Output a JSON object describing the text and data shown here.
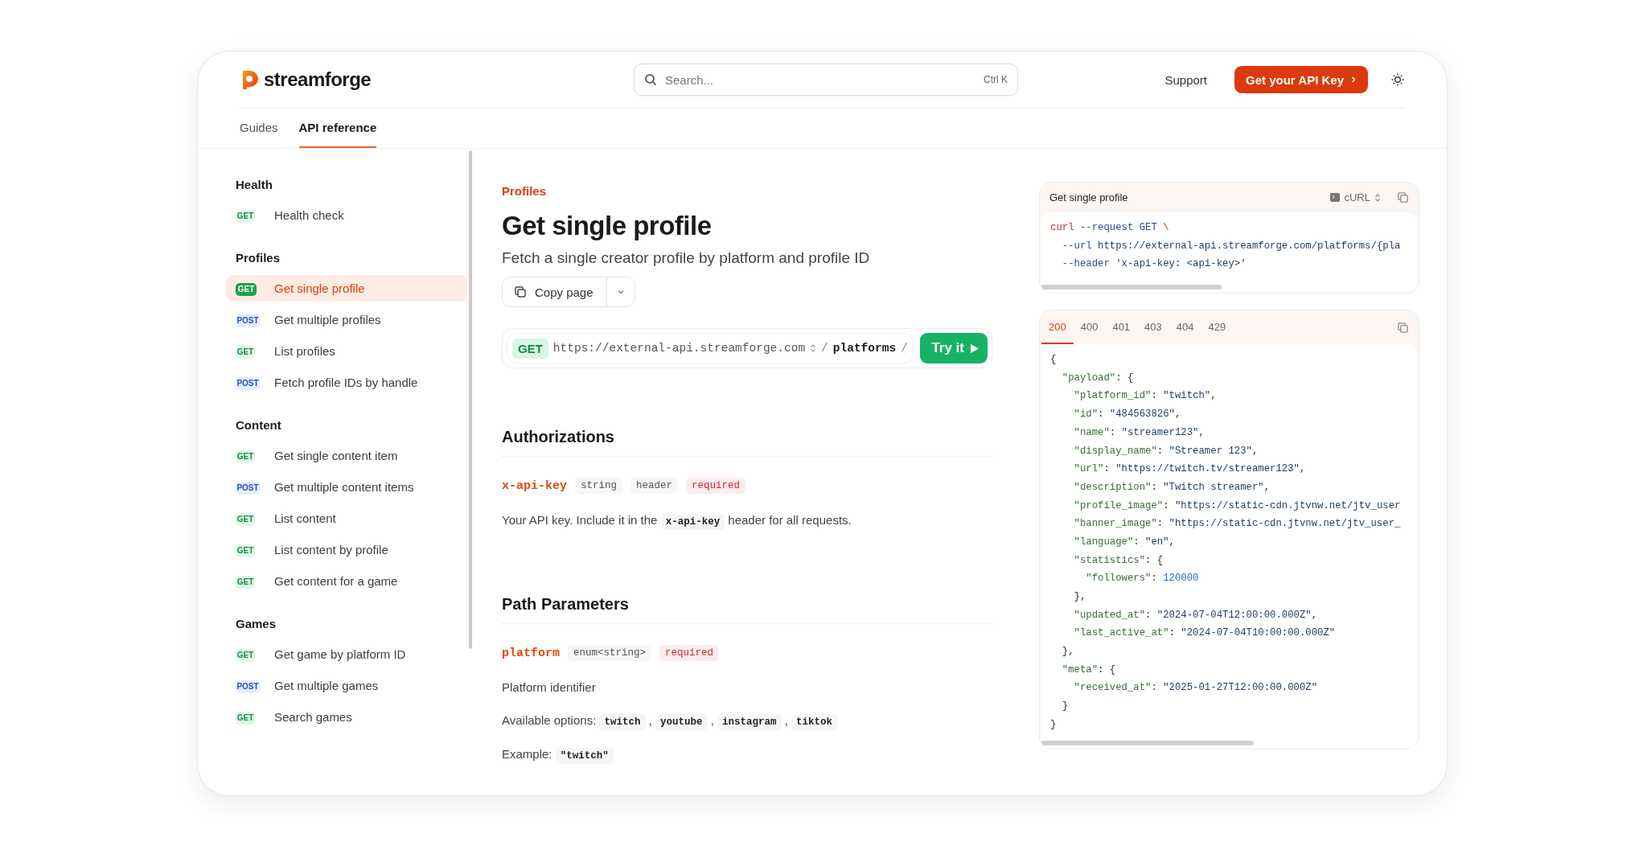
{
  "header": {
    "logo": "streamforge",
    "search": {
      "placeholder": "Search...",
      "shortcut": "Ctrl K"
    },
    "links": [
      "Support"
    ],
    "cta": "Get your API Key"
  },
  "tabs": [
    {
      "label": "Guides",
      "selected": false
    },
    {
      "label": "API reference",
      "selected": true
    }
  ],
  "sidebar": {
    "groups": [
      {
        "title": "Health",
        "items": [
          {
            "method": "GET",
            "label": "Health check",
            "selected": false
          }
        ]
      },
      {
        "title": "Profiles",
        "items": [
          {
            "method": "GET",
            "label": "Get single profile",
            "selected": true
          },
          {
            "method": "POST",
            "label": "Get multiple profiles",
            "selected": false
          },
          {
            "method": "GET",
            "label": "List profiles",
            "selected": false
          },
          {
            "method": "POST",
            "label": "Fetch profile IDs by handle",
            "selected": false
          }
        ]
      },
      {
        "title": "Content",
        "items": [
          {
            "method": "GET",
            "label": "Get single content item",
            "selected": false
          },
          {
            "method": "POST",
            "label": "Get multiple content items",
            "selected": false
          },
          {
            "method": "GET",
            "label": "List content",
            "selected": false
          },
          {
            "method": "GET",
            "label": "List content by profile",
            "selected": false
          },
          {
            "method": "GET",
            "label": "Get content for a game",
            "selected": false
          }
        ]
      },
      {
        "title": "Games",
        "items": [
          {
            "method": "GET",
            "label": "Get game by platform ID",
            "selected": false
          },
          {
            "method": "POST",
            "label": "Get multiple games",
            "selected": false
          },
          {
            "method": "GET",
            "label": "Search games",
            "selected": false
          }
        ]
      }
    ]
  },
  "page": {
    "breadcrumb": "Profiles",
    "title": "Get single profile",
    "subtitle": "Fetch a single creator profile by platform and profile ID",
    "copy_button": "Copy page",
    "endpoint": {
      "method": "GET",
      "base_url": "https://external-api.streamforge.com",
      "path": [
        {
          "text": "/",
          "kind": "sep"
        },
        {
          "text": "platforms",
          "kind": "segment"
        },
        {
          "text": "/",
          "kind": "sep"
        }
      ],
      "try_button": "Try it"
    },
    "sections": [
      {
        "title": "Authorizations",
        "params": [
          {
            "name": "x-api-key",
            "tags": [
              {
                "text": "string",
                "kind": "type"
              },
              {
                "text": "header",
                "kind": "type"
              },
              {
                "text": "required",
                "kind": "required"
              }
            ],
            "lines": [
              [
                {
                  "text": "Your API key. Include it in the ",
                  "kind": "text"
                },
                {
                  "text": "x-api-key",
                  "kind": "code"
                },
                {
                  "text": " header for all requests.",
                  "kind": "text"
                }
              ]
            ]
          }
        ]
      },
      {
        "title": "Path Parameters",
        "params": [
          {
            "name": "platform",
            "tags": [
              {
                "text": "enum<string>",
                "kind": "type"
              },
              {
                "text": "required",
                "kind": "required"
              }
            ],
            "lines": [
              [
                {
                  "text": "Platform identifier",
                  "kind": "text"
                }
              ],
              [
                {
                  "text": "Available options: ",
                  "kind": "text"
                },
                {
                  "text": "twitch",
                  "kind": "code"
                },
                {
                  "text": " , ",
                  "kind": "text"
                },
                {
                  "text": "youtube",
                  "kind": "code"
                },
                {
                  "text": " , ",
                  "kind": "text"
                },
                {
                  "text": "instagram",
                  "kind": "code"
                },
                {
                  "text": " , ",
                  "kind": "text"
                },
                {
                  "text": "tiktok",
                  "kind": "code"
                }
              ],
              [
                {
                  "text": "Example: ",
                  "kind": "text"
                },
                {
                  "text": "\"twitch\"",
                  "kind": "code"
                }
              ]
            ]
          }
        ]
      }
    ]
  },
  "request_panel": {
    "title": "Get single profile",
    "language": "cURL",
    "lines": [
      [
        {
          "text": "curl",
          "kind": "cmd"
        },
        {
          "text": " --request GET ",
          "kind": "flag"
        },
        {
          "text": "\\",
          "kind": "cmd"
        }
      ],
      [
        {
          "text": "  --url ",
          "kind": "flag"
        },
        {
          "text": "https://external-api.streamforge.com/platforms/{pla",
          "kind": "str"
        }
      ],
      [
        {
          "text": "  --header ",
          "kind": "flag"
        },
        {
          "text": "'x-api-key: <api-key>'",
          "kind": "str"
        }
      ]
    ]
  },
  "response_panel": {
    "statuses": [
      {
        "label": "200",
        "selected": true
      },
      {
        "label": "400",
        "selected": false
      },
      {
        "label": "401",
        "selected": false
      },
      {
        "label": "403",
        "selected": false
      },
      {
        "label": "404",
        "selected": false
      },
      {
        "label": "429",
        "selected": false
      }
    ],
    "lines": [
      [
        {
          "text": "{",
          "kind": "punct"
        }
      ],
      [
        {
          "text": "  \"payload\"",
          "kind": "key"
        },
        {
          "text": ": {",
          "kind": "punct"
        }
      ],
      [
        {
          "text": "    \"platform_id\"",
          "kind": "key"
        },
        {
          "text": ": ",
          "kind": "punct"
        },
        {
          "text": "\"twitch\"",
          "kind": "str"
        },
        {
          "text": ",",
          "kind": "punct"
        }
      ],
      [
        {
          "text": "    \"id\"",
          "kind": "key"
        },
        {
          "text": ": ",
          "kind": "punct"
        },
        {
          "text": "\"484563826\"",
          "kind": "str"
        },
        {
          "text": ",",
          "kind": "punct"
        }
      ],
      [
        {
          "text": "    \"name\"",
          "kind": "key"
        },
        {
          "text": ": ",
          "kind": "punct"
        },
        {
          "text": "\"streamer123\"",
          "kind": "str"
        },
        {
          "text": ",",
          "kind": "punct"
        }
      ],
      [
        {
          "text": "    \"display_name\"",
          "kind": "key"
        },
        {
          "text": ": ",
          "kind": "punct"
        },
        {
          "text": "\"Streamer 123\"",
          "kind": "str"
        },
        {
          "text": ",",
          "kind": "punct"
        }
      ],
      [
        {
          "text": "    \"url\"",
          "kind": "key"
        },
        {
          "text": ": ",
          "kind": "punct"
        },
        {
          "text": "\"https://twitch.tv/streamer123\"",
          "kind": "str"
        },
        {
          "text": ",",
          "kind": "punct"
        }
      ],
      [
        {
          "text": "    \"description\"",
          "kind": "key"
        },
        {
          "text": ": ",
          "kind": "punct"
        },
        {
          "text": "\"Twitch streamer\"",
          "kind": "str"
        },
        {
          "text": ",",
          "kind": "punct"
        }
      ],
      [
        {
          "text": "    \"profile_image\"",
          "kind": "key"
        },
        {
          "text": ": ",
          "kind": "punct"
        },
        {
          "text": "\"https://static-cdn.jtvnw.net/jtv_user",
          "kind": "str"
        }
      ],
      [
        {
          "text": "    \"banner_image\"",
          "kind": "key"
        },
        {
          "text": ": ",
          "kind": "punct"
        },
        {
          "text": "\"https://static-cdn.jtvnw.net/jtv_user_",
          "kind": "str"
        }
      ],
      [
        {
          "text": "    \"language\"",
          "kind": "key"
        },
        {
          "text": ": ",
          "kind": "punct"
        },
        {
          "text": "\"en\"",
          "kind": "str"
        },
        {
          "text": ",",
          "kind": "punct"
        }
      ],
      [
        {
          "text": "    \"statistics\"",
          "kind": "key"
        },
        {
          "text": ": {",
          "kind": "punct"
        }
      ],
      [
        {
          "text": "      \"followers\"",
          "kind": "key"
        },
        {
          "text": ": ",
          "kind": "punct"
        },
        {
          "text": "120000",
          "kind": "num"
        }
      ],
      [
        {
          "text": "    },",
          "kind": "punct"
        }
      ],
      [
        {
          "text": "    \"updated_at\"",
          "kind": "key"
        },
        {
          "text": ": ",
          "kind": "punct"
        },
        {
          "text": "\"2024-07-04T12:00:00.000Z\"",
          "kind": "str"
        },
        {
          "text": ",",
          "kind": "punct"
        }
      ],
      [
        {
          "text": "    \"last_active_at\"",
          "kind": "key"
        },
        {
          "text": ": ",
          "kind": "punct"
        },
        {
          "text": "\"2024-07-04T10:00:00.000Z\"",
          "kind": "str"
        }
      ],
      [
        {
          "text": "  },",
          "kind": "punct"
        }
      ],
      [
        {
          "text": "  \"meta\"",
          "kind": "key"
        },
        {
          "text": ": {",
          "kind": "punct"
        }
      ],
      [
        {
          "text": "    \"received_at\"",
          "kind": "key"
        },
        {
          "text": ": ",
          "kind": "punct"
        },
        {
          "text": "\"2025-01-27T12:00:00.000Z\"",
          "kind": "str"
        }
      ],
      [
        {
          "text": "  }",
          "kind": "punct"
        }
      ],
      [
        {
          "text": "}",
          "kind": "punct"
        }
      ]
    ]
  }
}
